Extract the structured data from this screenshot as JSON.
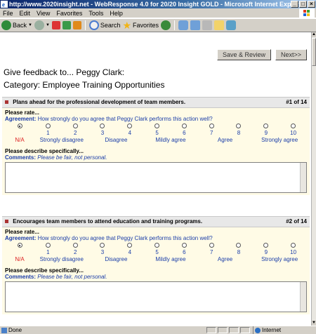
{
  "window": {
    "title": "http://www.2020insight.net - WebResponse 4.0 for 20/20 Insight GOLD - Microsoft Internet Explorer"
  },
  "menu": {
    "items": [
      "File",
      "Edit",
      "View",
      "Favorites",
      "Tools",
      "Help"
    ]
  },
  "toolbar": {
    "back_label": "Back",
    "search_label": "Search",
    "favorites_label": "Favorites"
  },
  "page": {
    "save_review_label": "Save & Review",
    "next_label": "Next>>",
    "feedback_heading": "Give feedback to... Peggy Clark:",
    "category_heading": "Category: Employee Training Opportunities",
    "questions": [
      {
        "title": "Plans ahead for the professional development of team members.",
        "number": "#1 of 14",
        "rate_label": "Please rate...",
        "agreement_label": "Agreement:",
        "agreement_text": "How strongly do you agree that Peggy Clark performs this action well?",
        "describe_label": "Please describe specifically...",
        "comments_label": "Comments:",
        "comments_hint": "Please be fair, not personal."
      },
      {
        "title": "Encourages team members to attend education and training programs.",
        "number": "#2 of 14",
        "rate_label": "Please rate...",
        "agreement_label": "Agreement:",
        "agreement_text": "How strongly do you agree that Peggy Clark performs this action well?",
        "describe_label": "Please describe specifically...",
        "comments_label": "Comments:",
        "comments_hint": "Please be fair, not personal."
      }
    ],
    "scale": {
      "na": "N/A",
      "numbers": [
        "1",
        "2",
        "3",
        "4",
        "5",
        "6",
        "7",
        "8",
        "9",
        "10"
      ],
      "labels": [
        "Strongly disagree",
        "Disagree",
        "Mildly agree",
        "Agree",
        "Strongly agree"
      ]
    }
  },
  "status": {
    "left": "Done",
    "zone": "Internet"
  },
  "colors": {
    "accent_blue": "#1a3da8",
    "na_red": "#d22222",
    "question_bg": "#fffbe6"
  }
}
